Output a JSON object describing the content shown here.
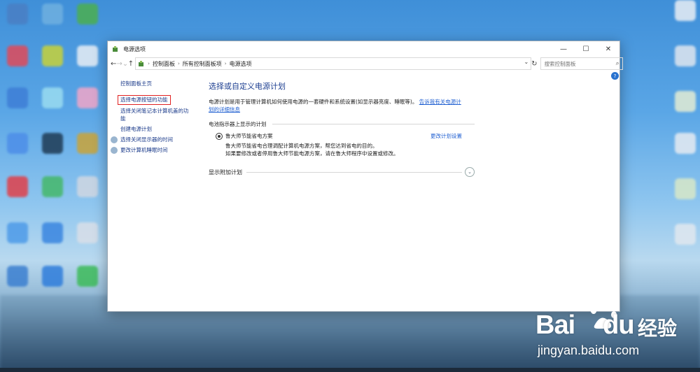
{
  "window": {
    "title": "电源选项",
    "minimize_glyph": "—",
    "maximize_glyph": "☐",
    "close_glyph": "✕"
  },
  "nav": {
    "back_glyph": "←",
    "forward_glyph": "→",
    "up_glyph": "↑",
    "refresh_glyph": "↻",
    "dropdown_glyph": "⌄"
  },
  "breadcrumb": [
    "控制面板",
    "所有控制面板项",
    "电源选项"
  ],
  "search": {
    "placeholder": "搜索控制面板",
    "icon": "search-icon"
  },
  "left_pane": {
    "home": "控制面板主页",
    "links": [
      "选择电源按钮的功能",
      "选择关闭笔记本计算机盖的功",
      "能",
      "创建电源计划",
      "选择关闭显示器的时间",
      "更改计算机睡眠时间"
    ]
  },
  "main": {
    "heading": "选择或自定义电源计划",
    "desc_line1": "电源计划是用于管理计算机如何使用电源的一套硬件和系统设置(如显示器亮度、睡眠等)。",
    "desc_link1": "告诉我有关电源计",
    "desc_link2": "划的详细信息",
    "group_label": "电池指示器上显示的计划",
    "plan_name": "鲁大师节能省电方案",
    "plan_change": "更改计划设置",
    "plan_desc1": "鲁大师节能省电合理调配计算机电源方案，帮您达到省电的目的。",
    "plan_desc2": "如果要修改或者停用鲁大师节能电源方案，请在鲁大师程序中设置或修改。",
    "more_label": "显示附加计划"
  },
  "watermark": {
    "brand": "Bai",
    "brand_tail": "du",
    "cn": "经验",
    "url": "jingyan.baidu.com"
  },
  "colors": {
    "link": "#1f5fd1",
    "heading": "#1d3f91",
    "highlight_box": "#e02020"
  }
}
